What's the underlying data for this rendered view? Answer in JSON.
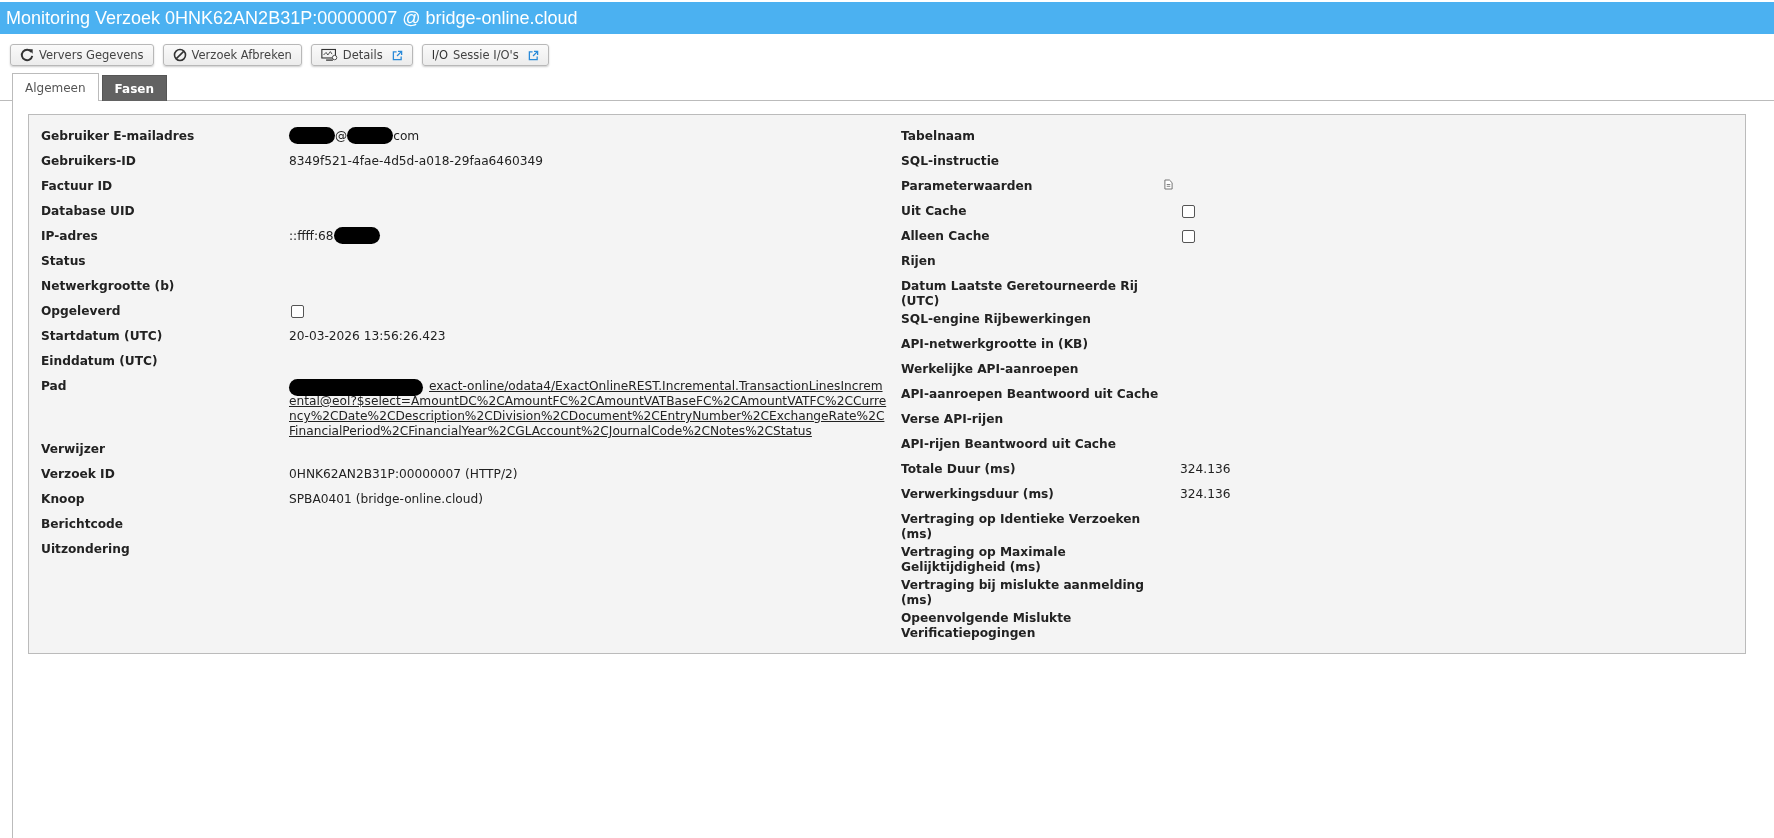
{
  "window": {
    "title": "Monitoring Verzoek 0HNK62AN2B31P:00000007 @ bridge-online.cloud"
  },
  "toolbar": [
    {
      "kind": "refresh",
      "label": "Ververs Gegevens",
      "external": false
    },
    {
      "kind": "cancel",
      "label": "Verzoek Afbreken",
      "external": false
    },
    {
      "kind": "monitor",
      "label": "Details",
      "external": true
    },
    {
      "kind": "io",
      "icon_text": "I/O",
      "label": "Sessie I/O's",
      "external": true
    }
  ],
  "tabs": [
    {
      "label": "Algemeen",
      "selected": true
    },
    {
      "label": "Fasen",
      "selected": false
    }
  ],
  "left_fields": [
    {
      "label": "Gebruiker E-mailadres",
      "kind": "parts",
      "parts": [
        {
          "kind": "redacted"
        },
        {
          "kind": "text",
          "text": "@"
        },
        {
          "kind": "redacted"
        },
        {
          "kind": "text",
          "text": "com"
        }
      ]
    },
    {
      "label": "Gebruikers-ID",
      "kind": "text",
      "value": "8349f521-4fae-4d5d-a018-29faa6460349"
    },
    {
      "label": "Factuur ID",
      "kind": "empty"
    },
    {
      "label": "Database UID",
      "kind": "empty"
    },
    {
      "label": "IP-adres",
      "kind": "parts",
      "parts": [
        {
          "kind": "text",
          "text": "::ffff:68"
        },
        {
          "kind": "redacted"
        }
      ]
    },
    {
      "label": "Status",
      "kind": "empty"
    },
    {
      "label": "Netwerkgrootte (b)",
      "kind": "empty"
    },
    {
      "label": "Opgeleverd",
      "kind": "checkbox",
      "checked": false
    },
    {
      "label": "Startdatum (UTC)",
      "kind": "text",
      "value": "20-03-2026 13:56:26.423"
    },
    {
      "label": "Einddatum (UTC)",
      "kind": "empty"
    },
    {
      "label": "Pad",
      "kind": "parts",
      "parts": [
        {
          "kind": "redacted"
        },
        {
          "kind": "link",
          "text": "exact-online/odata4/ExactOnlineREST.Incremental.TransactionLinesIncremental@eol?$select=AmountDC%2CAmountFC%2CAmountVATBaseFC%2CAmountVATFC%2CCurrency%2CDate%2CDescription%2CDivision%2CDocument%2CEntryNumber%2CExchangeRate%2CFinancialPeriod%2CFinancialYear%2CGLAccount%2CJournalCode%2CNotes%2CStatus"
        }
      ]
    },
    {
      "label": "Verwijzer",
      "kind": "empty"
    },
    {
      "label": "Verzoek ID",
      "kind": "text",
      "value": "0HNK62AN2B31P:00000007 (HTTP/2)"
    },
    {
      "label": "Knoop",
      "kind": "text",
      "value": "SPBA0401 (bridge-online.cloud)"
    },
    {
      "label": "Berichtcode",
      "kind": "empty"
    },
    {
      "label": "Uitzondering",
      "kind": "empty"
    }
  ],
  "right_fields": [
    {
      "label": "Tabelnaam",
      "kind": "empty"
    },
    {
      "label": "SQL-instructie",
      "kind": "empty"
    },
    {
      "label": "Parameterwaarden",
      "kind": "copy"
    },
    {
      "label": "Uit Cache",
      "kind": "checkbox",
      "checked": false
    },
    {
      "label": "Alleen Cache",
      "kind": "checkbox",
      "checked": false
    },
    {
      "label": "Rijen",
      "kind": "empty"
    },
    {
      "label": "Datum Laatste Geretourneerde Rij (UTC)",
      "kind": "empty"
    },
    {
      "label": "SQL-engine Rijbewerkingen",
      "kind": "empty"
    },
    {
      "label": "API-netwerkgrootte in (KB)",
      "kind": "empty"
    },
    {
      "label": "Werkelijke API-aanroepen",
      "kind": "empty"
    },
    {
      "label": "API-aanroepen Beantwoord uit Cache",
      "kind": "empty"
    },
    {
      "label": "Verse API-rijen",
      "kind": "empty"
    },
    {
      "label": "API-rijen Beantwoord uit Cache",
      "kind": "empty"
    },
    {
      "label": "Totale Duur (ms)",
      "kind": "text",
      "value": "324.136"
    },
    {
      "label": "Verwerkingsduur (ms)",
      "kind": "text",
      "value": "324.136"
    },
    {
      "label": "Vertraging op Identieke Verzoeken (ms)",
      "kind": "empty"
    },
    {
      "label": "Vertraging op Maximale Gelijktijdigheid (ms)",
      "kind": "empty"
    },
    {
      "label": "Vertraging bij mislukte aanmelding (ms)",
      "kind": "empty"
    },
    {
      "label": "Opeenvolgende Mislukte Verificatiepogingen",
      "kind": "empty"
    }
  ]
}
